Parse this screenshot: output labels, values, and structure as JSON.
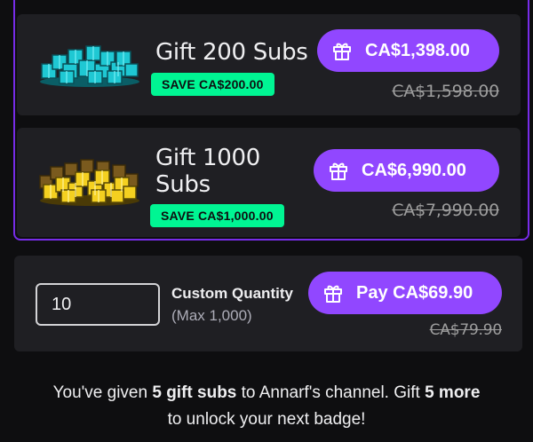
{
  "colors": {
    "background": "#0e0e10",
    "card": "#1f1f23",
    "accent_purple": "#9147ff",
    "selected_border": "#772ce8",
    "save_badge": "#00f593",
    "muted": "#adadb8"
  },
  "offers": [
    {
      "title": "Gift 200 Subs",
      "save_label": "SAVE CA$200.00",
      "price_label": "CA$1,398.00",
      "original_price": "CA$1,598.00",
      "art_icon": "gift-pile-teal-icon",
      "button_icon": "gift-icon"
    },
    {
      "title_line1": "Gift 1000",
      "title_line2": "Subs",
      "save_label": "SAVE CA$1,000.00",
      "price_label": "CA$6,990.00",
      "original_price": "CA$7,990.00",
      "art_icon": "gift-pile-gold-icon",
      "button_icon": "gift-icon"
    }
  ],
  "custom": {
    "quantity_value": "10",
    "label": "Custom Quantity",
    "max_label": "(Max 1,000)",
    "pay_label": "Pay CA$69.90",
    "original_price": "CA$79.90",
    "button_icon": "gift-icon"
  },
  "footer": {
    "part1": "You've given ",
    "bold1": "5 gift subs",
    "part2": " to Annarf's channel. Gift ",
    "bold2": "5 more",
    "part3": " to unlock your next badge!"
  }
}
